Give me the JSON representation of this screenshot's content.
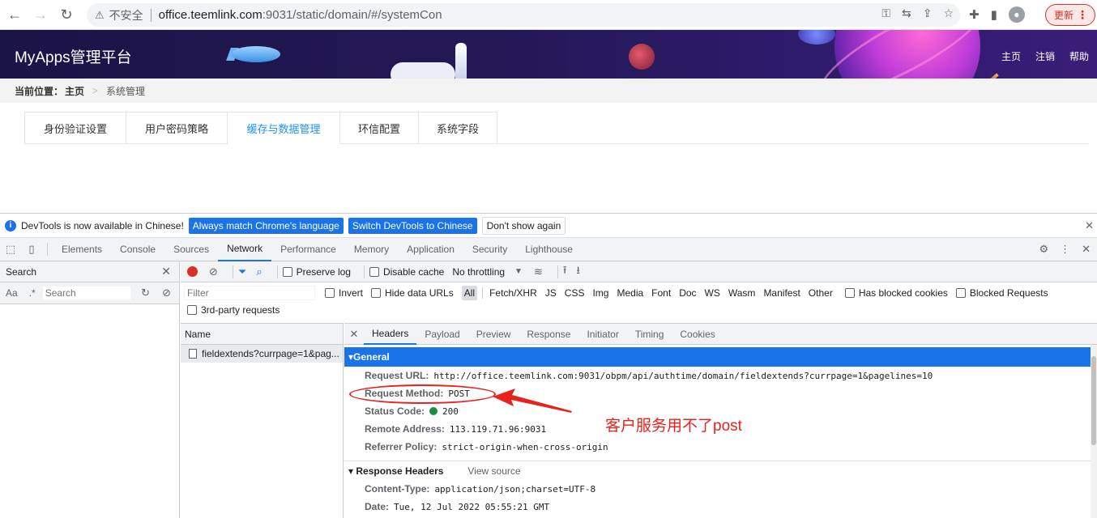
{
  "browser": {
    "insecure_label": "不安全",
    "url_host": "office.teemlink.com",
    "url_rest": ":9031/static/domain/#/systemCon",
    "update_label": "更新"
  },
  "app": {
    "title": "MyApps管理平台",
    "header_links": [
      "主页",
      "注销",
      "帮助"
    ]
  },
  "breadcrumb": {
    "label": "当前位置：",
    "home": "主页",
    "sep": ">",
    "current": "系统管理"
  },
  "tabs": [
    {
      "label": "身份验证设置",
      "active": false
    },
    {
      "label": "用户密码策略",
      "active": false
    },
    {
      "label": "缓存与数据管理",
      "active": true
    },
    {
      "label": "环信配置",
      "active": false
    },
    {
      "label": "系统字段",
      "active": false
    }
  ],
  "devtools": {
    "info_text": "DevTools is now available in Chinese!",
    "info_btn_match": "Always match Chrome's language",
    "info_btn_switch": "Switch DevTools to Chinese",
    "info_btn_dont": "Don't show again",
    "tabs": [
      "Elements",
      "Console",
      "Sources",
      "Network",
      "Performance",
      "Memory",
      "Application",
      "Security",
      "Lighthouse"
    ],
    "active_tab": "Network",
    "search": {
      "title": "Search",
      "aa": "Aa",
      "regex": ".*",
      "placeholder": "Search"
    },
    "toolbar": {
      "preserve_log": "Preserve log",
      "disable_cache": "Disable cache",
      "throttling": "No throttling"
    },
    "filter": {
      "placeholder": "Filter",
      "invert": "Invert",
      "hide_data_urls": "Hide data URLs",
      "types": [
        "All",
        "Fetch/XHR",
        "JS",
        "CSS",
        "Img",
        "Media",
        "Font",
        "Doc",
        "WS",
        "Wasm",
        "Manifest",
        "Other"
      ],
      "has_blocked_cookies": "Has blocked cookies",
      "blocked_requests": "Blocked Requests",
      "third_party": "3rd-party requests"
    },
    "request_list": {
      "header": "Name",
      "rows": [
        "fieldextends?currpage=1&pag..."
      ]
    },
    "detail": {
      "tabs": [
        "Headers",
        "Payload",
        "Preview",
        "Response",
        "Initiator",
        "Timing",
        "Cookies"
      ],
      "active_tab": "Headers",
      "general_title": "General",
      "general": [
        {
          "k": "Request URL:",
          "v": "http://office.teemlink.com:9031/obpm/api/authtime/domain/fieldextends?currpage=1&pagelines=10"
        },
        {
          "k": "Request Method:",
          "v": "POST"
        },
        {
          "k": "Status Code:",
          "v": "200"
        },
        {
          "k": "Remote Address:",
          "v": "113.119.71.96:9031"
        },
        {
          "k": "Referrer Policy:",
          "v": "strict-origin-when-cross-origin"
        }
      ],
      "response_title": "Response Headers",
      "view_source": "View source",
      "response": [
        {
          "k": "Content-Type:",
          "v": "application/json;charset=UTF-8"
        },
        {
          "k": "Date:",
          "v": "Tue, 12 Jul 2022 05:55:21 GMT"
        }
      ]
    }
  },
  "annotation": {
    "text": "客户服务用不了post",
    "color": "#e8221c"
  }
}
